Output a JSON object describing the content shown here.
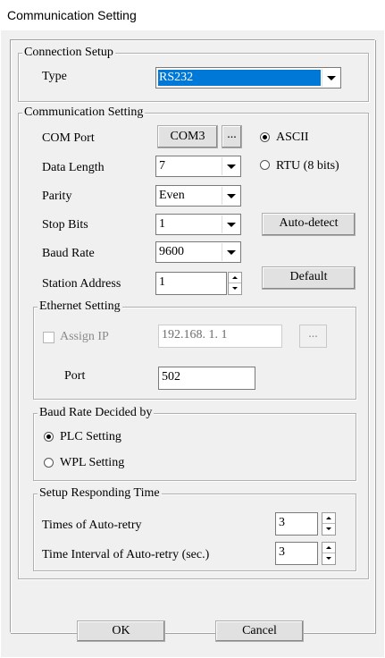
{
  "window": {
    "title": "Communication Setting"
  },
  "connection_setup": {
    "legend": "Connection Setup",
    "type_label": "Type",
    "type_value": "RS232"
  },
  "communication_setting": {
    "legend": "Communication Setting",
    "com_port_label": "COM Port",
    "com_port_value": "COM3",
    "browse_label": "...",
    "data_length_label": "Data Length",
    "data_length_value": "7",
    "parity_label": "Parity",
    "parity_value": "Even",
    "stop_bits_label": "Stop Bits",
    "stop_bits_value": "1",
    "baud_rate_label": "Baud Rate",
    "baud_rate_value": "9600",
    "station_address_label": "Station Address",
    "station_address_value": "1",
    "ascii_label": "ASCII",
    "rtu_label": "RTU (8 bits)",
    "auto_detect_label": "Auto-detect",
    "default_label": "Default",
    "mode_selected": "ASCII"
  },
  "ethernet_setting": {
    "legend": "Ethernet Setting",
    "assign_ip_label": "Assign IP",
    "ip_value": "192.168.  1.  1",
    "ip_browse_label": "...",
    "port_label": "Port",
    "port_value": "502"
  },
  "baud_rate_decided": {
    "legend": "Baud Rate Decided by",
    "plc_label": "PLC Setting",
    "wpl_label": "WPL Setting",
    "selected": "PLC Setting"
  },
  "responding_time": {
    "legend": "Setup Responding Time",
    "retry_label": "Times of Auto-retry",
    "retry_value": "3",
    "interval_label": "Time Interval of Auto-retry (sec.)",
    "interval_value": "3"
  },
  "buttons": {
    "ok": "OK",
    "cancel": "Cancel"
  }
}
